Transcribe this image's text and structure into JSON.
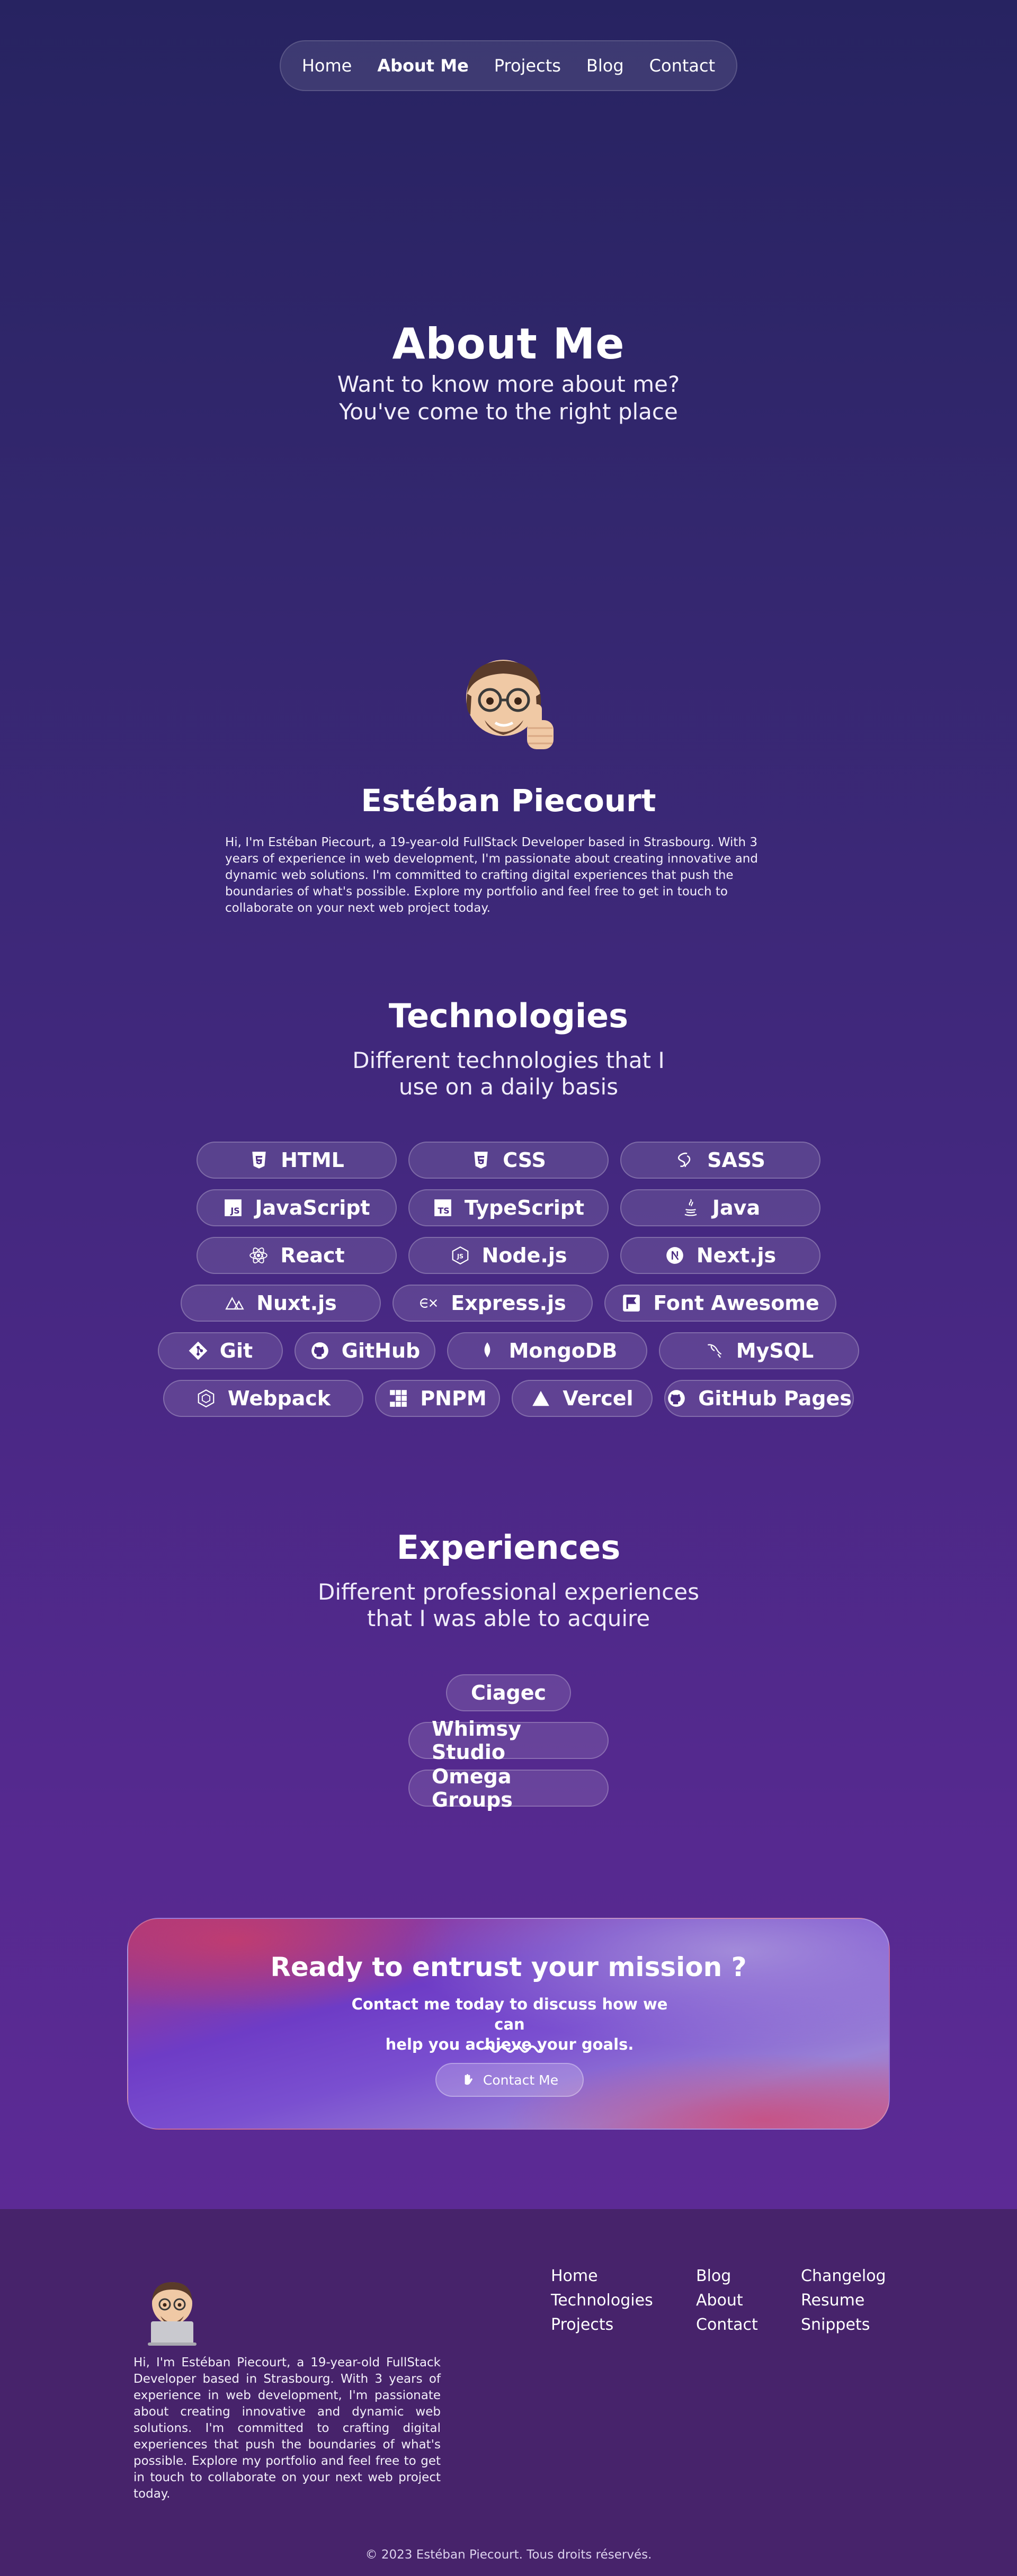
{
  "nav": {
    "items": [
      {
        "label": "Home"
      },
      {
        "label": "About Me"
      },
      {
        "label": "Projects"
      },
      {
        "label": "Blog"
      },
      {
        "label": "Contact"
      }
    ],
    "active": "About Me"
  },
  "hero": {
    "title": "About Me",
    "subtitle_line1": "Want to know more about me?",
    "subtitle_line2": "You've come to the right place"
  },
  "profile": {
    "avatar_icon": "memoji-thumbs-up-icon",
    "name": "Estéban Piecourt",
    "bio": "Hi, I'm Estéban Piecourt, a 19-year-old FullStack Developer based in Strasbourg. With 3 years of experience in web development, I'm passionate about creating innovative and dynamic web solutions. I'm committed to crafting digital experiences that push the boundaries of what's possible. Explore my portfolio and feel free to get in touch to collaborate on your next web project today."
  },
  "technologies": {
    "title": "Technologies",
    "subtitle_line1": "Different technologies that I",
    "subtitle_line2": "use on a daily basis",
    "rows": [
      [
        {
          "label": "HTML",
          "icon": "html5-icon"
        },
        {
          "label": "CSS",
          "icon": "css3-icon"
        },
        {
          "label": "SASS",
          "icon": "sass-icon"
        }
      ],
      [
        {
          "label": "JavaScript",
          "icon": "javascript-icon"
        },
        {
          "label": "TypeScript",
          "icon": "typescript-icon"
        },
        {
          "label": "Java",
          "icon": "java-icon"
        }
      ],
      [
        {
          "label": "React",
          "icon": "react-icon"
        },
        {
          "label": "Node.js",
          "icon": "nodejs-icon"
        },
        {
          "label": "Next.js",
          "icon": "nextjs-icon"
        }
      ],
      [
        {
          "label": "Nuxt.js",
          "icon": "nuxtjs-icon"
        },
        {
          "label": "Express.js",
          "icon": "expressjs-icon"
        },
        {
          "label": "Font Awesome",
          "icon": "font-awesome-icon"
        }
      ],
      [
        {
          "label": "Git",
          "icon": "git-icon"
        },
        {
          "label": "GitHub",
          "icon": "github-icon"
        },
        {
          "label": "MongoDB",
          "icon": "mongodb-icon"
        },
        {
          "label": "MySQL",
          "icon": "mysql-icon"
        }
      ],
      [
        {
          "label": "Webpack",
          "icon": "webpack-icon"
        },
        {
          "label": "PNPM",
          "icon": "pnpm-icon"
        },
        {
          "label": "Vercel",
          "icon": "vercel-icon"
        },
        {
          "label": "GitHub Pages",
          "icon": "github-icon"
        }
      ]
    ]
  },
  "experiences": {
    "title": "Experiences",
    "subtitle_line1": "Different professional experiences",
    "subtitle_line2": "that I was able to acquire",
    "items": [
      {
        "label": "Ciagec"
      },
      {
        "label": "Whimsy Studio"
      },
      {
        "label": "Omega Groups"
      }
    ]
  },
  "cta": {
    "title": "Ready to entrust your mission ?",
    "text_line1": "Contact me today to discuss how we can",
    "text_line2": "help you achieve your goals.",
    "button_label": "Contact Me",
    "button_icon": "waving-hand-icon"
  },
  "footer": {
    "avatar_icon": "memoji-laptop-icon",
    "bio": "Hi, I'm Estéban Piecourt, a 19-year-old FullStack Developer based in Strasbourg. With 3 years of experience in web development, I'm passionate about creating innovative and dynamic web solutions. I'm committed to crafting digital experiences that push the boundaries of what's possible. Explore my portfolio and feel free to get in touch to collaborate on your next web project today.",
    "columns": [
      {
        "links": [
          {
            "label": "Home"
          },
          {
            "label": "Technologies"
          },
          {
            "label": "Projects"
          }
        ]
      },
      {
        "links": [
          {
            "label": "Blog"
          },
          {
            "label": "About"
          },
          {
            "label": "Contact"
          }
        ]
      },
      {
        "links": [
          {
            "label": "Changelog"
          },
          {
            "label": "Resume"
          },
          {
            "label": "Snippets"
          }
        ]
      }
    ],
    "copyright": "© 2023 Estéban Piecourt. Tous droits réservés."
  },
  "colors": {
    "bg_top": "#272361",
    "bg_bottom": "#5c2a95",
    "footer_bg": "#47236b",
    "text": "#ffffff"
  }
}
